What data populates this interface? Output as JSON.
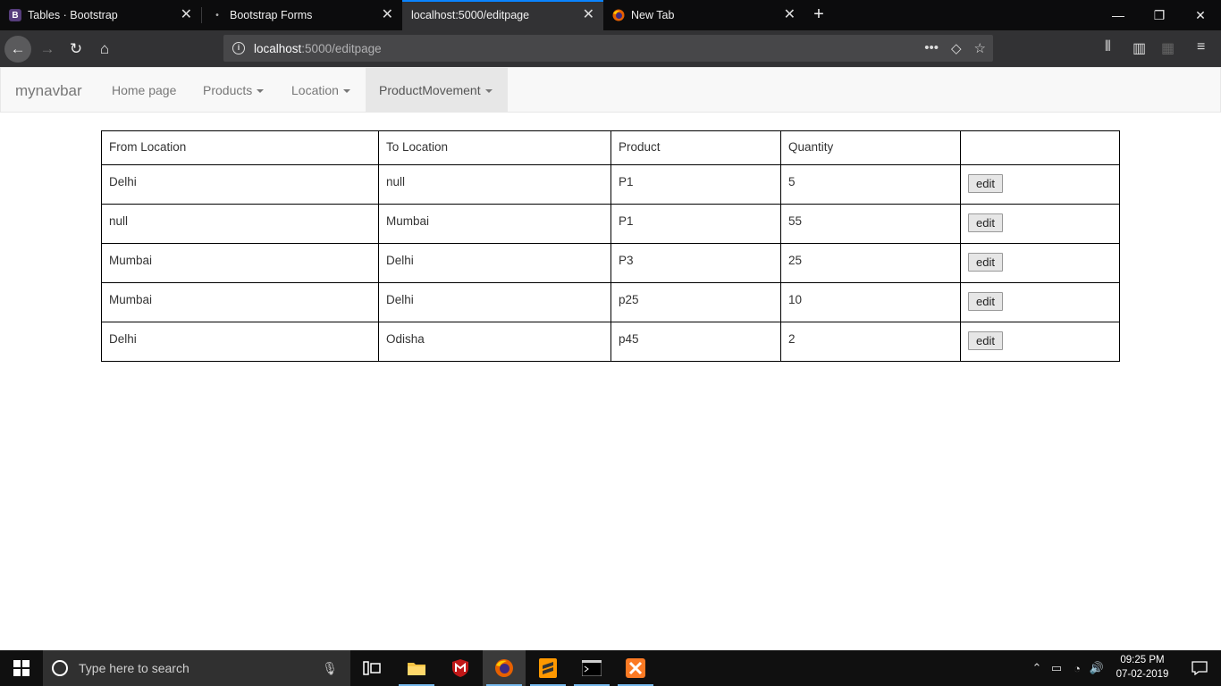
{
  "browser": {
    "tabs": [
      {
        "title": "Tables · Bootstrap",
        "favicon": "B"
      },
      {
        "title": "Bootstrap Forms",
        "favicon": "•"
      },
      {
        "title": "localhost:5000/editpage",
        "favicon": ""
      },
      {
        "title": "New Tab",
        "favicon": "firefox-icon"
      }
    ],
    "active_tab": 2,
    "url_host": "localhost",
    "url_path": ":5000/editpage"
  },
  "navbar": {
    "brand": "mynavbar",
    "links": [
      "Home page",
      "Products",
      "Location",
      "ProductMovement"
    ]
  },
  "table": {
    "headers": [
      "From Location",
      "To Location",
      "Product",
      "Quantity",
      ""
    ],
    "rows": [
      [
        "Delhi",
        "null",
        "P1",
        "5"
      ],
      [
        "null",
        "Mumbai",
        "P1",
        "55"
      ],
      [
        "Mumbai",
        "Delhi",
        "P3",
        "25"
      ],
      [
        "Mumbai",
        "Delhi",
        "p25",
        "10"
      ],
      [
        "Delhi",
        "Odisha",
        "p45",
        "2"
      ]
    ],
    "action_label": "edit"
  },
  "taskbar": {
    "search_placeholder": "Type here to search",
    "time": "09:25 PM",
    "date": "07-02-2019"
  }
}
